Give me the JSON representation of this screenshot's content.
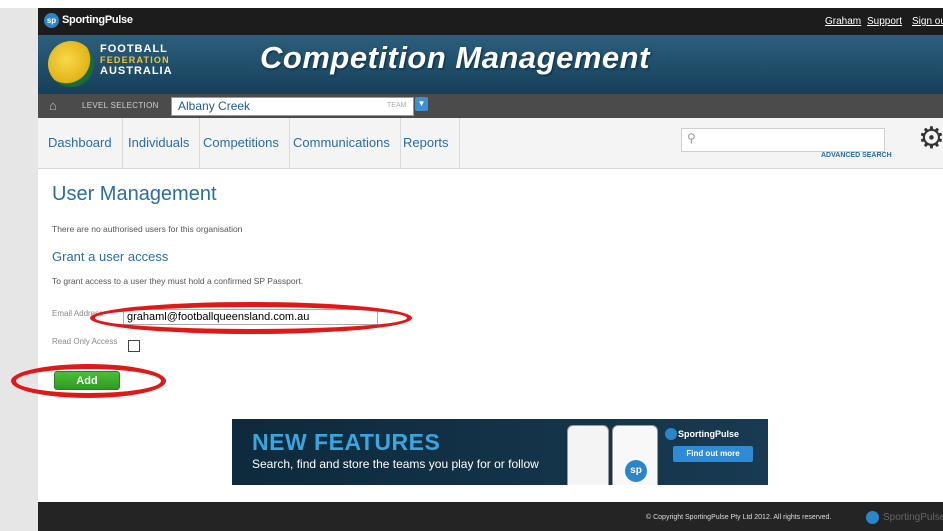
{
  "topbar": {
    "brand": "SportingPulse",
    "logo_text": "sp",
    "links": [
      "Graham",
      "Support",
      "Sign out"
    ]
  },
  "banner": {
    "org_line1": "FOOTBALL",
    "org_line2": "FEDERATION",
    "org_line3": "AUSTRALIA",
    "title": "Competition Management"
  },
  "levelbar": {
    "label": "LEVEL SELECTION",
    "value": "Albany Creek",
    "type": "TEAM",
    "dropdown_icon": "chevron-down-icon"
  },
  "nav": {
    "items": [
      "Dashboard",
      "Individuals",
      "Competitions",
      "Communications",
      "Reports"
    ],
    "search_placeholder": "",
    "advanced_search": "ADVANCED SEARCH"
  },
  "main": {
    "page_title": "User Management",
    "no_users_text": "There are no authorised users for this organisation",
    "section_title": "Grant a user access",
    "instruction": "To grant access to a user they must hold a confirmed SP Passport.",
    "email_label": "Email Address",
    "email_value": "grahaml@footballqueensland.com.au",
    "readonly_label": "Read Only Access",
    "add_button": "Add"
  },
  "ad": {
    "title": "NEW FEATURES",
    "subtitle": "Search, find and store the teams you play for or follow",
    "brand": "SportingPulse",
    "button": "Find out more",
    "logo_text": "sp"
  },
  "footer": {
    "copyright": "© Copyright SportingPulse Pty Ltd  2012.  All rights reserved.",
    "brand": "SportingPulse"
  },
  "colors": {
    "accent_blue": "#2a6ca3",
    "add_green": "#3aaa2e",
    "annotation_red": "#e01818"
  }
}
